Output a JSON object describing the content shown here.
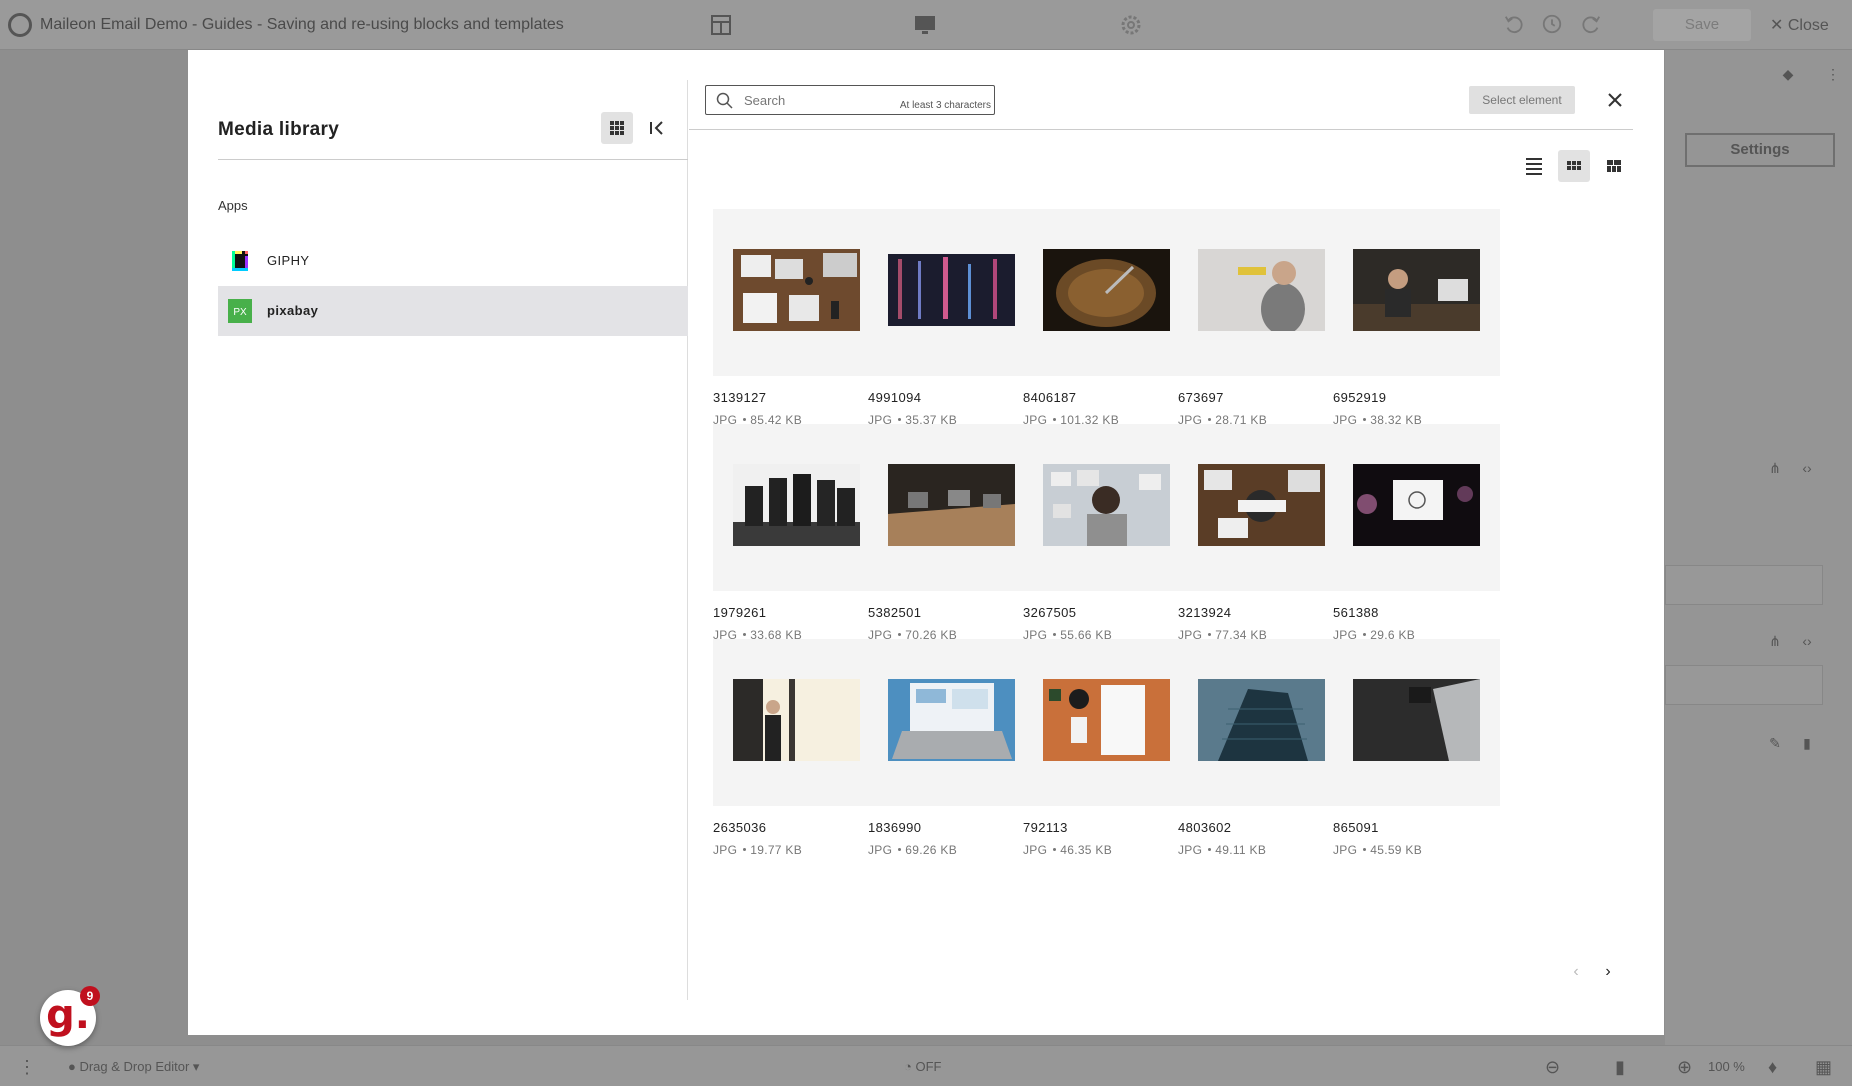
{
  "app": {
    "title": "Maileon Email Demo - Guides - Saving and re-using blocks and templates",
    "save_label": "Save",
    "close_label": "Close",
    "settings_label": "Settings",
    "editor_label": "Drag & Drop Editor",
    "zoom_label": "100 %",
    "toggle_label": "OFF"
  },
  "badge": {
    "letter": "g.",
    "count": "9"
  },
  "modal": {
    "title": "Media library",
    "apps_heading": "Apps",
    "apps": [
      {
        "name": "GIPHY",
        "icon": "giphy-icon",
        "active": false
      },
      {
        "name": "pixabay",
        "icon": "pixabay-icon",
        "active": true
      }
    ],
    "search": {
      "placeholder": "Search",
      "value": "",
      "hint": "At least 3 characters"
    },
    "select_element_label": "Select element",
    "items": [
      {
        "name": "3139127",
        "type": "JPG",
        "size": "85.42 KB"
      },
      {
        "name": "4991094",
        "type": "JPG",
        "size": "35.37 KB"
      },
      {
        "name": "8406187",
        "type": "JPG",
        "size": "101.32 KB"
      },
      {
        "name": "673697",
        "type": "JPG",
        "size": "28.71 KB"
      },
      {
        "name": "6952919",
        "type": "JPG",
        "size": "38.32 KB"
      },
      {
        "name": "1979261",
        "type": "JPG",
        "size": "33.68 KB"
      },
      {
        "name": "5382501",
        "type": "JPG",
        "size": "70.26 KB"
      },
      {
        "name": "3267505",
        "type": "JPG",
        "size": "55.66 KB"
      },
      {
        "name": "3213924",
        "type": "JPG",
        "size": "77.34 KB"
      },
      {
        "name": "561388",
        "type": "JPG",
        "size": "29.6 KB"
      },
      {
        "name": "2635036",
        "type": "JPG",
        "size": "19.77 KB"
      },
      {
        "name": "1836990",
        "type": "JPG",
        "size": "69.26 KB"
      },
      {
        "name": "792113",
        "type": "JPG",
        "size": "46.35 KB"
      },
      {
        "name": "4803602",
        "type": "JPG",
        "size": "49.11 KB"
      },
      {
        "name": "865091",
        "type": "JPG",
        "size": "45.59 KB"
      }
    ]
  },
  "colors": {
    "overlay": "#8e8e8e",
    "active_app_bg": "#e3e3e6",
    "pixabay_green": "#48b04a",
    "brand_red": "#c0101e"
  }
}
